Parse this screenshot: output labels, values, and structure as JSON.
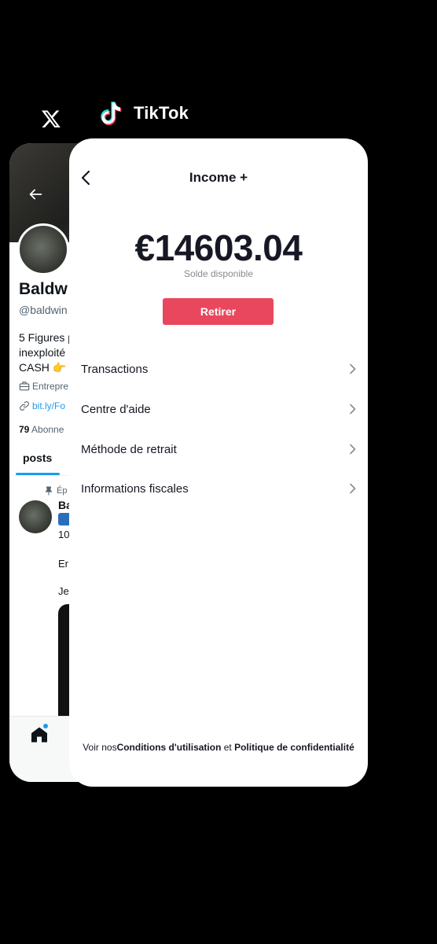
{
  "app_switcher": {
    "x_app_name": "",
    "tiktok_app_name": "TikTok"
  },
  "x_card": {
    "profile_name": "Baldw",
    "handle": "@baldwin",
    "bio_lines": [
      "5 Figures p",
      "inexploité",
      "CASH 👉"
    ],
    "job": "Entrepre",
    "link": "bit.ly/Fo",
    "followers_count": "79",
    "followers_label": "Abonne",
    "tab_posts": "posts",
    "pinned_label": "Ép",
    "post_name": "Ba",
    "post_line2": "10",
    "post_line3": "Er",
    "post_line4": "Je",
    "colors": {
      "accent": "#1d9bf0"
    }
  },
  "tiktok_card": {
    "header_title": "Income +",
    "balance": "€14603.04",
    "balance_caption": "Solde disponible",
    "withdraw_button": "Retirer",
    "menu_items": [
      {
        "label": "Transactions"
      },
      {
        "label": "Centre d'aide"
      },
      {
        "label": "Méthode de retrait"
      },
      {
        "label": "Informations fiscales"
      }
    ],
    "footer": {
      "prefix": "Voir nos",
      "terms": "Conditions d'utilisation",
      "conjunction": " et ",
      "privacy": "Politique de confidentialité"
    },
    "colors": {
      "button": "#e9475d",
      "text": "#161823",
      "muted": "#8a8b91"
    }
  }
}
